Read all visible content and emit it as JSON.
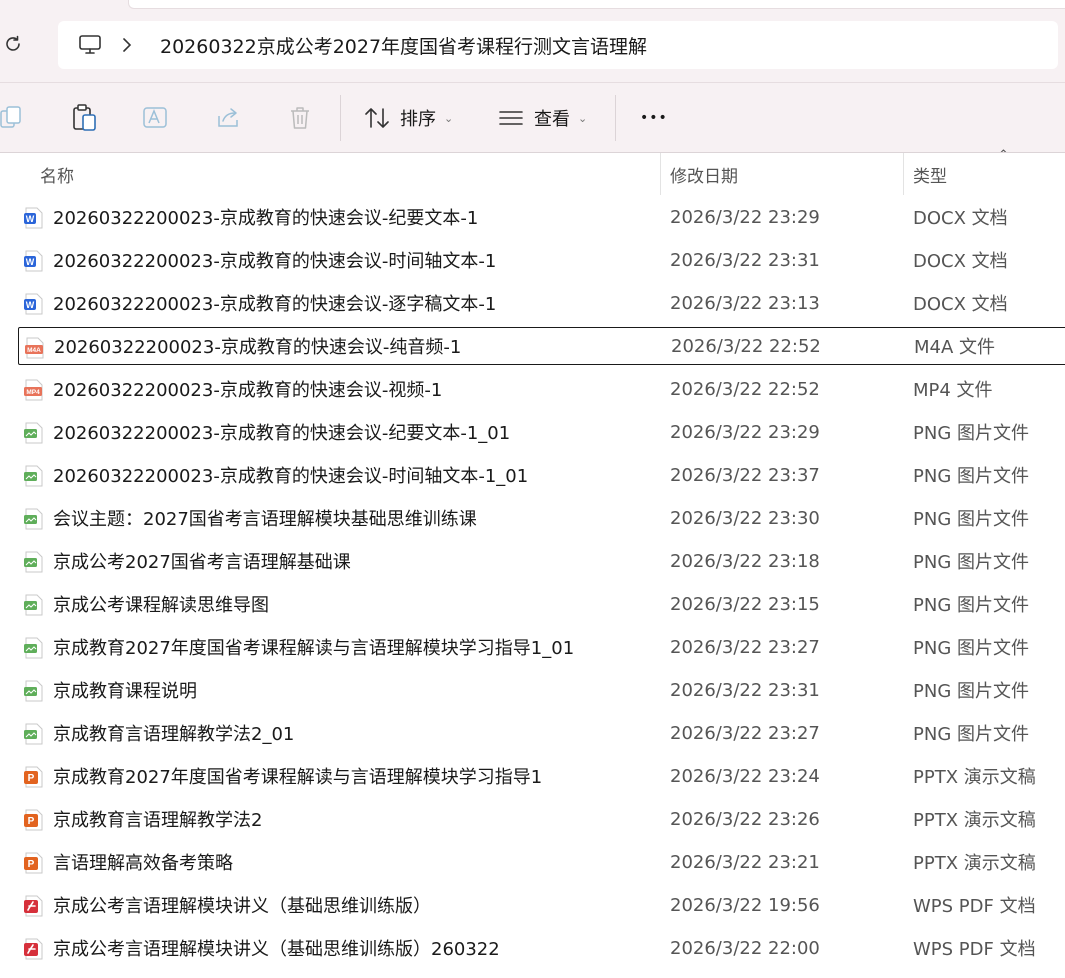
{
  "address": {
    "location_icon": "computer-icon",
    "path": "20260322京成公考2027年度国省考课程行测文言语理解"
  },
  "toolbar": {
    "sort_label": "排序",
    "view_label": "查看",
    "more_label": "•••"
  },
  "columns": {
    "name": "名称",
    "modified": "修改日期",
    "type": "类型"
  },
  "files": [
    {
      "icon": "docx",
      "name": "20260322200023-京成教育的快速会议-纪要文本-1",
      "date": "2026/3/22 23:29",
      "type": "DOCX 文档",
      "selected": false
    },
    {
      "icon": "docx",
      "name": "20260322200023-京成教育的快速会议-时间轴文本-1",
      "date": "2026/3/22 23:31",
      "type": "DOCX 文档",
      "selected": false
    },
    {
      "icon": "docx",
      "name": "20260322200023-京成教育的快速会议-逐字稿文本-1",
      "date": "2026/3/22 23:13",
      "type": "DOCX 文档",
      "selected": false
    },
    {
      "icon": "m4a",
      "icon_text": "M4A",
      "name": "20260322200023-京成教育的快速会议-纯音频-1",
      "date": "2026/3/22 22:52",
      "type": "M4A 文件",
      "selected": true
    },
    {
      "icon": "mp4",
      "icon_text": "MP4",
      "name": "20260322200023-京成教育的快速会议-视频-1",
      "date": "2026/3/22 22:52",
      "type": "MP4 文件",
      "selected": false
    },
    {
      "icon": "png",
      "name": "20260322200023-京成教育的快速会议-纪要文本-1_01",
      "date": "2026/3/22 23:29",
      "type": "PNG 图片文件",
      "selected": false
    },
    {
      "icon": "png",
      "name": "20260322200023-京成教育的快速会议-时间轴文本-1_01",
      "date": "2026/3/22 23:37",
      "type": "PNG 图片文件",
      "selected": false
    },
    {
      "icon": "png",
      "name": "会议主题：2027国省考言语理解模块基础思维训练课",
      "date": "2026/3/22 23:30",
      "type": "PNG 图片文件",
      "selected": false
    },
    {
      "icon": "png",
      "name": "京成公考2027国省考言语理解基础课",
      "date": "2026/3/22 23:18",
      "type": "PNG 图片文件",
      "selected": false
    },
    {
      "icon": "png",
      "name": "京成公考课程解读思维导图",
      "date": "2026/3/22 23:15",
      "type": "PNG 图片文件",
      "selected": false
    },
    {
      "icon": "png",
      "name": "京成教育2027年度国省考课程解读与言语理解模块学习指导1_01",
      "date": "2026/3/22 23:27",
      "type": "PNG 图片文件",
      "selected": false
    },
    {
      "icon": "png",
      "name": "京成教育课程说明",
      "date": "2026/3/22 23:31",
      "type": "PNG 图片文件",
      "selected": false
    },
    {
      "icon": "png",
      "name": "京成教育言语理解教学法2_01",
      "date": "2026/3/22 23:27",
      "type": "PNG 图片文件",
      "selected": false
    },
    {
      "icon": "pptx",
      "name": "京成教育2027年度国省考课程解读与言语理解模块学习指导1",
      "date": "2026/3/22 23:24",
      "type": "PPTX 演示文稿",
      "selected": false
    },
    {
      "icon": "pptx",
      "name": "京成教育言语理解教学法2",
      "date": "2026/3/22 23:26",
      "type": "PPTX 演示文稿",
      "selected": false
    },
    {
      "icon": "pptx",
      "name": "言语理解高效备考策略",
      "date": "2026/3/22 23:21",
      "type": "PPTX 演示文稿",
      "selected": false
    },
    {
      "icon": "pdf",
      "name": "京成公考言语理解模块讲义（基础思维训练版）",
      "date": "2026/3/22 19:56",
      "type": "WPS PDF 文档",
      "selected": false
    },
    {
      "icon": "pdf",
      "name": "京成公考言语理解模块讲义（基础思维训练版）260322",
      "date": "2026/3/22 22:00",
      "type": "WPS PDF 文档",
      "selected": false
    }
  ],
  "colors": {
    "chrome": "#f7f1f3",
    "docx": "#2b65d9",
    "pptx": "#e2631f",
    "pdf": "#d6303b",
    "media": "#e8735a",
    "png": "#5fae5a"
  }
}
